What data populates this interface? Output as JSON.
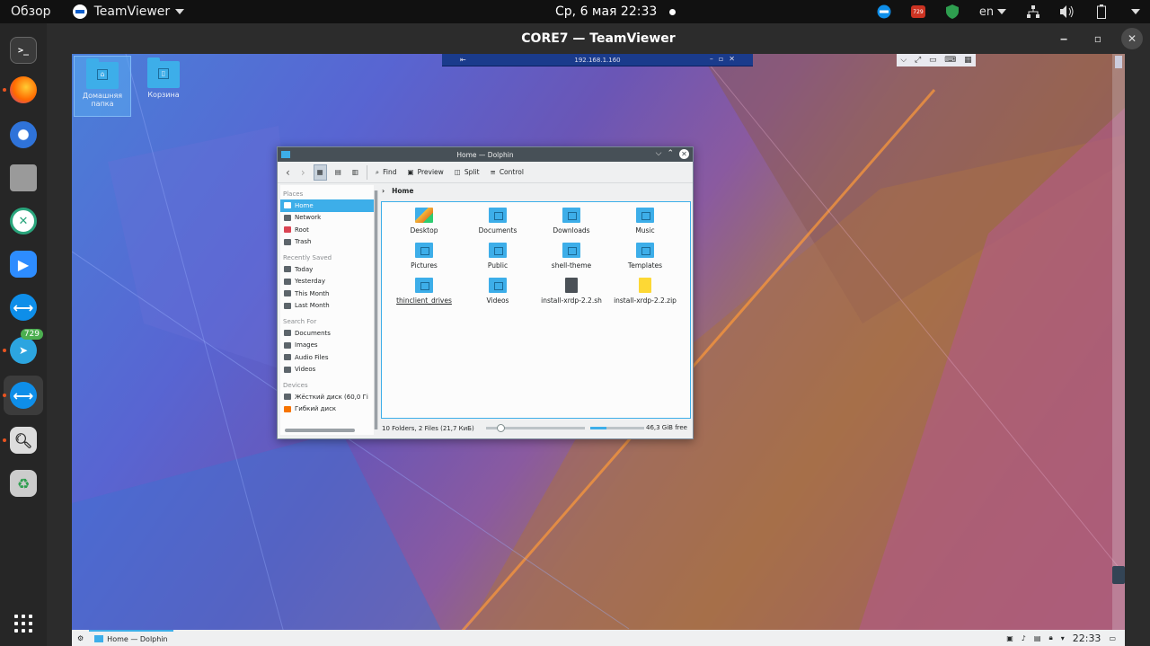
{
  "topbar": {
    "activities": "Обзор",
    "app_name": "TeamViewer",
    "clock": "Ср, 6 мая  22:33",
    "tray_badge": "729",
    "language": "en"
  },
  "dock": {
    "telegram_badge": "729"
  },
  "teamviewer": {
    "title": "CORE7 — TeamViewer",
    "ribbon_address": "192.168.1.160"
  },
  "remote_desktop": {
    "icons": [
      {
        "label": "Домашняя папка"
      },
      {
        "label": "Корзина"
      }
    ]
  },
  "dolphin": {
    "title": "Home — Dolphin",
    "toolbar": {
      "find": "Find",
      "preview": "Preview",
      "split": "Split",
      "control": "Control"
    },
    "places_sections": {
      "places": "Places",
      "recent": "Recently Saved",
      "search": "Search For",
      "devices": "Devices"
    },
    "places": [
      "Home",
      "Network",
      "Root",
      "Trash"
    ],
    "recent": [
      "Today",
      "Yesterday",
      "This Month",
      "Last Month"
    ],
    "search": [
      "Documents",
      "Images",
      "Audio Files",
      "Videos"
    ],
    "devices": [
      "Жёсткий диск (60,0 Гі",
      "Гибкий диск"
    ],
    "breadcrumb": "Home",
    "files": [
      {
        "name": "Desktop"
      },
      {
        "name": "Documents"
      },
      {
        "name": "Downloads"
      },
      {
        "name": "Music"
      },
      {
        "name": "Pictures"
      },
      {
        "name": "Public"
      },
      {
        "name": "shell-theme"
      },
      {
        "name": "Templates"
      },
      {
        "name": "thinclient_drives"
      },
      {
        "name": "Videos"
      },
      {
        "name": "install-xrdp-2.2.sh"
      },
      {
        "name": "install-xrdp-2.2.zip"
      }
    ],
    "status": "10 Folders, 2 Files (21,7 КиБ)",
    "free_space": "46,3 GiB free",
    "disk_fill_fraction": 0.3
  },
  "remote_taskbar": {
    "task_label": "Home — Dolphin",
    "clock": "22:33"
  },
  "colors": {
    "accent": "#3daee9",
    "ubuntu_orange": "#e95420"
  }
}
